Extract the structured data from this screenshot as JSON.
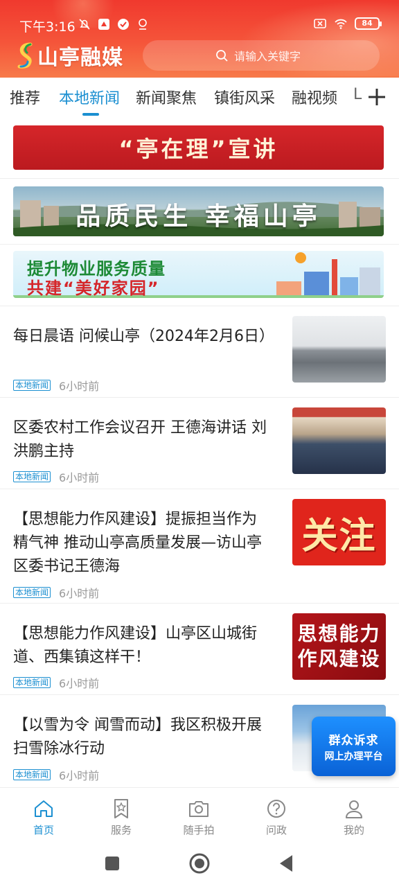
{
  "status_bar": {
    "time": "下午3:16",
    "battery": "84"
  },
  "header": {
    "app_name": "山亭融媒",
    "search_placeholder": "请输入关键字"
  },
  "tabs": [
    {
      "label": "推荐",
      "active": false
    },
    {
      "label": "本地新闻",
      "active": true
    },
    {
      "label": "新闻聚焦",
      "active": false
    },
    {
      "label": "镇街风采",
      "active": false
    },
    {
      "label": "融视频",
      "active": false
    },
    {
      "label": "L",
      "active": false
    }
  ],
  "banners": {
    "b1": "“亭在理”宣讲",
    "b2": "品质民生 幸福山亭",
    "b3_line1": "提升物业服务质量",
    "b3_line2": "共建“美好家园”"
  },
  "news": [
    {
      "title": "每日晨语  问候山亭（2024年2月6日）",
      "tag": "本地新闻",
      "time": "6小时前"
    },
    {
      "title": "区委农村工作会议召开  王德海讲话 刘洪鹏主持",
      "tag": "本地新闻",
      "time": "6小时前"
    },
    {
      "title": "【思想能力作风建设】提振担当作为 精气神  推动山亭高质量发展—访山亭区委书记王德海",
      "tag": "本地新闻",
      "time": "6小时前",
      "thumb_text": "关注"
    },
    {
      "title": "【思想能力作风建设】山亭区山城街道、西集镇这样干！",
      "tag": "本地新闻",
      "time": "6小时前",
      "thumb_line1": "思想能力",
      "thumb_line2": "作风建设"
    },
    {
      "title": "【以雪为令  闻雪而动】我区积极开展扫雪除冰行动",
      "tag": "本地新闻",
      "time": "6小时前"
    }
  ],
  "float_badge": {
    "line1": "群众诉求",
    "line2": "网上办理平台"
  },
  "bottom_nav": [
    {
      "label": "首页",
      "icon": "home-icon",
      "active": true
    },
    {
      "label": "服务",
      "icon": "bookmark-star-icon",
      "active": false
    },
    {
      "label": "随手拍",
      "icon": "camera-icon",
      "active": false
    },
    {
      "label": "问政",
      "icon": "question-icon",
      "active": false
    },
    {
      "label": "我的",
      "icon": "user-icon",
      "active": false
    }
  ],
  "colors": {
    "header_red": "#f0392e",
    "accent_blue": "#1b8fd1",
    "banner_red": "#d6262a"
  }
}
